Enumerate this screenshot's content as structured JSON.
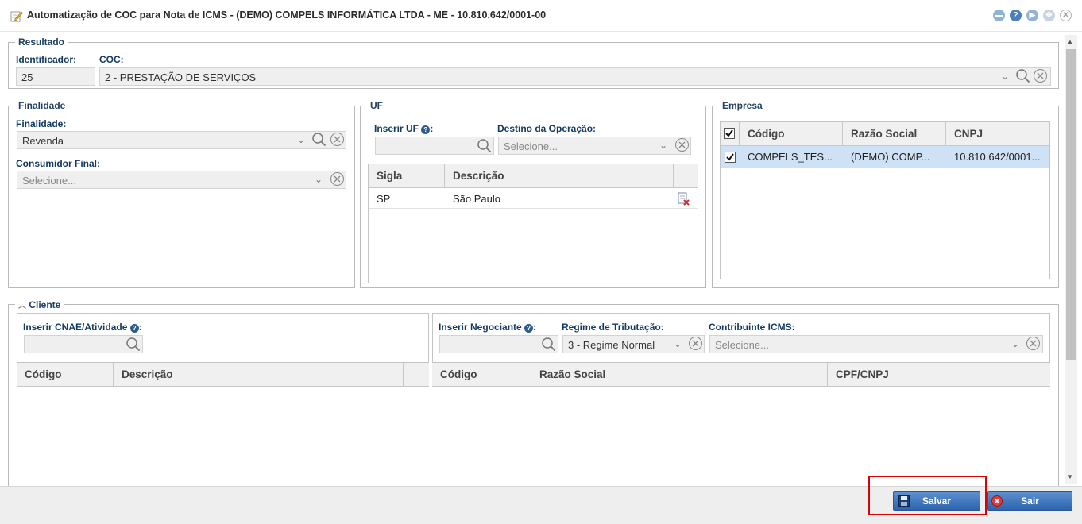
{
  "window": {
    "title": "Automatização de COC para Nota de ICMS - (DEMO) COMPELS INFORMÁTICA LTDA - ME - 10.810.642/0001-00"
  },
  "resultado": {
    "legend": "Resultado",
    "identificador_label": "Identificador:",
    "identificador_value": "25",
    "coc_label": "COC:",
    "coc_value": "2 - PRESTAÇÃO DE SERVIÇOS"
  },
  "finalidade": {
    "legend": "Finalidade",
    "finalidade_label": "Finalidade:",
    "finalidade_value": "Revenda",
    "consumidor_label": "Consumidor Final:",
    "consumidor_placeholder": "Selecione..."
  },
  "uf": {
    "legend": "UF",
    "inserir_label": "Inserir UF",
    "destino_label": "Destino da Operação:",
    "destino_placeholder": "Selecione...",
    "columns": [
      "Sigla",
      "Descrição"
    ],
    "rows": [
      {
        "sigla": "SP",
        "descricao": "São Paulo"
      }
    ]
  },
  "empresa": {
    "legend": "Empresa",
    "columns": [
      "Código",
      "Razão Social",
      "CNPJ"
    ],
    "rows": [
      {
        "codigo": "COMPELS_TES...",
        "razao": "(DEMO) COMP...",
        "cnpj": "10.810.642/0001...",
        "checked": true
      }
    ]
  },
  "cliente": {
    "legend": "Cliente",
    "cnae_label": "Inserir CNAE/Atividade",
    "cnae_columns": [
      "Código",
      "Descrição"
    ],
    "negociante_label": "Inserir Negociante",
    "regime_label": "Regime de Tributação:",
    "regime_value": "3 - Regime Normal",
    "contribuinte_label": "Contribuinte ICMS:",
    "contribuinte_placeholder": "Selecione...",
    "neg_columns": [
      "Código",
      "Razão Social",
      "CPF/CNPJ"
    ]
  },
  "footer": {
    "save_label": "Salvar",
    "exit_label": "Sair"
  },
  "colors": {
    "accent": "#1f3f64",
    "selected_row": "#cfe2f5",
    "button": "#2d64ad",
    "highlight": "#e00000"
  }
}
